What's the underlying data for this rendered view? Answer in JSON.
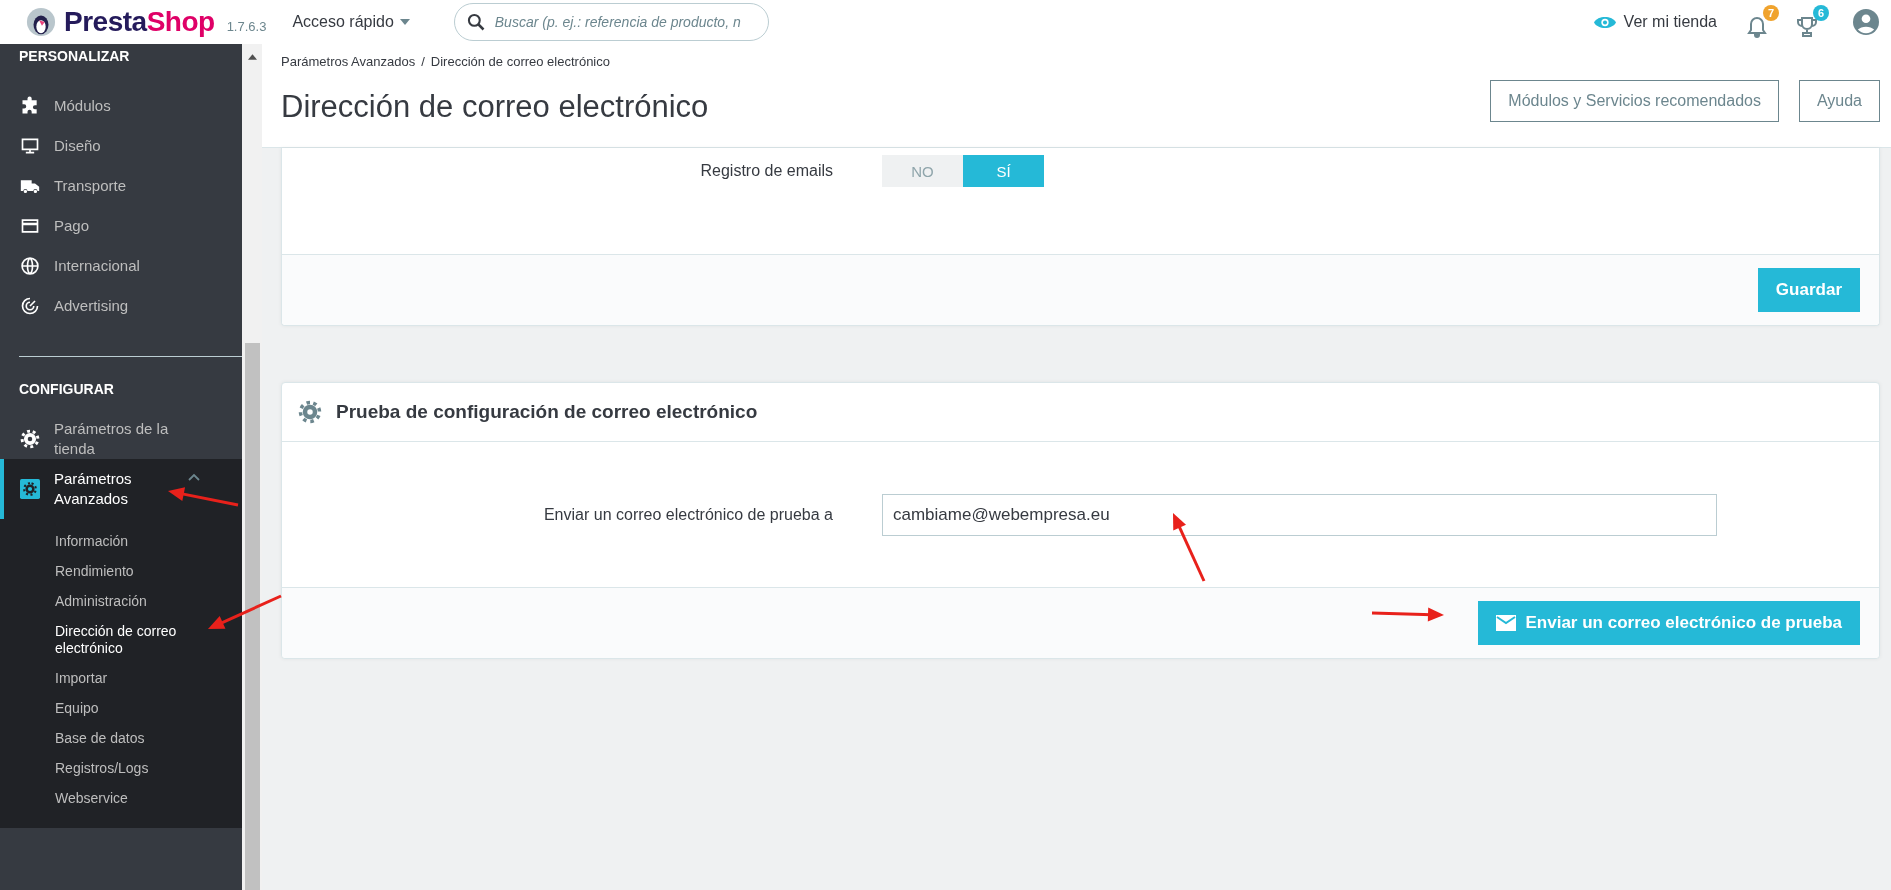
{
  "topbar": {
    "logo": {
      "text_1": "Presta",
      "text_2": "Shop"
    },
    "version": "1.7.6.3",
    "quick_access": "Acceso rápido",
    "search": {
      "placeholder": "Buscar (p. ej.: referencia de producto, n"
    },
    "view_store": "Ver mi tienda",
    "notifications": [
      {
        "count": "7",
        "color": "#f0a32d"
      },
      {
        "count": "6",
        "color": "#25b9d7"
      }
    ]
  },
  "sidebar": {
    "sections": [
      {
        "title": "PERSONALIZAR",
        "items": [
          {
            "label": "Módulos",
            "selected": false
          },
          {
            "label": "Diseño",
            "selected": false
          },
          {
            "label": "Transporte",
            "selected": false
          },
          {
            "label": "Pago",
            "selected": false
          },
          {
            "label": "Internacional",
            "selected": false
          },
          {
            "label": "Advertising",
            "selected": false
          }
        ]
      },
      {
        "title": "CONFIGURAR",
        "items": [
          {
            "label": "Parámetros de la tienda",
            "selected": false
          },
          {
            "label": "Parámetros Avanzados",
            "selected": true,
            "expanded": true,
            "children": [
              {
                "label": "Información",
                "selected": false
              },
              {
                "label": "Rendimiento",
                "selected": false
              },
              {
                "label": "Administración",
                "selected": false
              },
              {
                "label": "Dirección de correo electrónico",
                "selected": true
              },
              {
                "label": "Importar",
                "selected": false
              },
              {
                "label": "Equipo",
                "selected": false
              },
              {
                "label": "Base de datos",
                "selected": false
              },
              {
                "label": "Registros/Logs",
                "selected": false
              },
              {
                "label": "Webservice",
                "selected": false
              }
            ]
          }
        ]
      }
    ]
  },
  "header": {
    "breadcrumb": [
      "Parámetros Avanzados",
      "Dirección de correo electrónico"
    ],
    "separator": "/",
    "title": "Dirección de correo electrónico",
    "buttons": [
      "Módulos y Servicios recomendados",
      "Ayuda"
    ]
  },
  "log_card": {
    "label": "Registro de emails",
    "options": [
      {
        "label": "NO",
        "selected": false
      },
      {
        "label": "SÍ",
        "selected": true
      }
    ],
    "save_button": "Guardar"
  },
  "test_card": {
    "title": "Prueba de configuración de correo electrónico",
    "label": "Enviar un correo electrónico de prueba a",
    "value": "cambiame@webempresa.eu",
    "send_button": "Enviar un correo electrónico de prueba"
  }
}
